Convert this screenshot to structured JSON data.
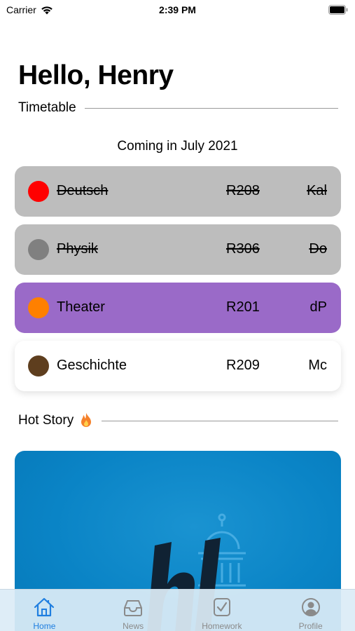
{
  "status_bar": {
    "carrier": "Carrier",
    "time": "2:39 PM"
  },
  "greeting": "Hello, Henry",
  "timetable": {
    "header": "Timetable",
    "coming": "Coming in July 2021",
    "lessons": [
      {
        "subject": "Deutsch",
        "room": "R208",
        "teacher": "Kal",
        "dot_color": "#ff0000",
        "state": "cancelled"
      },
      {
        "subject": "Physik",
        "room": "R306",
        "teacher": "Do",
        "dot_color": "#808080",
        "state": "cancelled"
      },
      {
        "subject": "Theater",
        "room": "R201",
        "teacher": "dP",
        "dot_color": "#ff8000",
        "state": "active",
        "card_color": "#9a6ac8"
      },
      {
        "subject": "Geschichte",
        "room": "R209",
        "teacher": "Mc",
        "dot_color": "#5e3e1e",
        "state": "normal"
      }
    ]
  },
  "hot_story": {
    "header": "Hot Story",
    "icon": "fire-icon",
    "image_color": "#0a84c6"
  },
  "tab_bar": {
    "selected": "Home",
    "tabs": [
      {
        "label": "Home",
        "icon": "house-icon"
      },
      {
        "label": "News",
        "icon": "tray-icon"
      },
      {
        "label": "Homework",
        "icon": "checkbox-icon"
      },
      {
        "label": "Profile",
        "icon": "person-circle-icon"
      }
    ]
  },
  "colors": {
    "accent": "#1f7ee0",
    "tab_inactive": "#8a8a8a",
    "cancelled_card": "#bdbdbd"
  }
}
